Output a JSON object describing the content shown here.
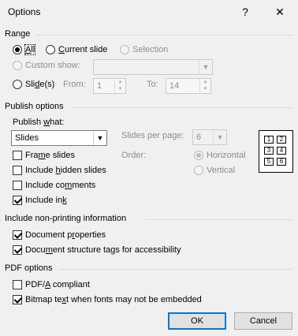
{
  "window": {
    "title": "Options",
    "help_label": "?",
    "close_label": "✕"
  },
  "range": {
    "heading": "Range",
    "all_pre": "",
    "all_u": "A",
    "all_post": "ll",
    "current_pre": "",
    "current_u": "C",
    "current_post": "urrent slide",
    "selection_label": "Selection",
    "custom_show_label": "Custom show:",
    "custom_show_value": "",
    "slides_pre": "Sli",
    "slides_u": "d",
    "slides_post": "e(s)",
    "from_label": "From:",
    "from_value": "1",
    "to_label": "To:",
    "to_value": "14"
  },
  "publish": {
    "heading": "Publish options",
    "publish_what_pre": "Publish ",
    "publish_what_u": "w",
    "publish_what_post": "hat:",
    "publish_what_value": "Slides",
    "slides_per_page_label": "Slides per page:",
    "slides_per_page_value": "6",
    "order_label": "Order:",
    "horizontal_label": "Horizontal",
    "vertical_label": "Vertical",
    "frame_pre": "Fra",
    "frame_u": "m",
    "frame_post": "e slides",
    "hidden_pre": "Include ",
    "hidden_u": "h",
    "hidden_post": "idden slides",
    "comments_pre": "Include co",
    "comments_u": "m",
    "comments_post": "ments",
    "ink_pre": "Include in",
    "ink_u": "k",
    "ink_post": "",
    "preview_cells": [
      "1",
      "2",
      "3",
      "4",
      "5",
      "6"
    ]
  },
  "nonprinting": {
    "heading": "Include non-printing information",
    "docprops_pre": "Document p",
    "docprops_u": "r",
    "docprops_post": "operties",
    "structure_pre": "Docu",
    "structure_u": "m",
    "structure_post": "ent structure tags for accessibility"
  },
  "pdf": {
    "heading": "PDF options",
    "pdfa_pre": "PDF/",
    "pdfa_u": "A",
    "pdfa_post": " compliant",
    "bitmap_pre": "Bitmap te",
    "bitmap_u": "x",
    "bitmap_post": "t when fonts may not be embedded"
  },
  "buttons": {
    "ok_label": "OK",
    "cancel_label": "Cancel"
  },
  "state": {
    "range_selected": "All",
    "order_selected": "Horizontal",
    "frame_slides": false,
    "include_hidden": false,
    "include_comments": false,
    "include_ink": true,
    "document_properties": true,
    "structure_tags": true,
    "pdfa_compliant": false,
    "bitmap_text": true
  },
  "colors": {
    "accent": "#0078d7",
    "dialog_bg": "#f0f0f0",
    "disabled_text": "#8d8d8d"
  }
}
